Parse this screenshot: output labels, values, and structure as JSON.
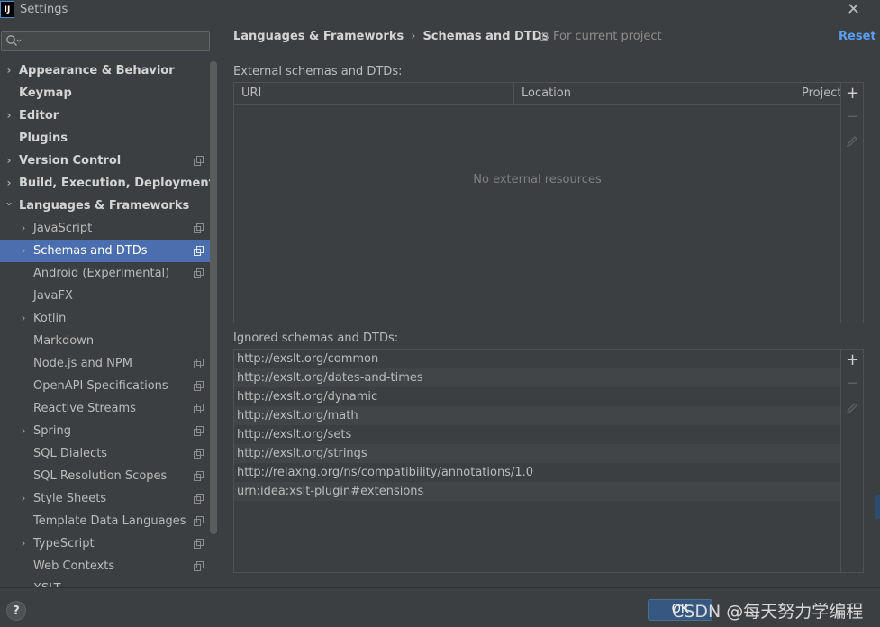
{
  "window": {
    "title": "Settings",
    "app_icon_text": "IJ",
    "close_glyph": "✕"
  },
  "search": {
    "placeholder": "",
    "icon": "search-icon"
  },
  "sidebar": {
    "items": [
      {
        "label": "Appearance & Behavior",
        "level": 0,
        "bold": true,
        "expandable": true,
        "expanded": false,
        "project": false,
        "selected": false
      },
      {
        "label": "Keymap",
        "level": 0,
        "bold": true,
        "expandable": false,
        "expanded": false,
        "project": false,
        "selected": false
      },
      {
        "label": "Editor",
        "level": 0,
        "bold": true,
        "expandable": true,
        "expanded": false,
        "project": false,
        "selected": false
      },
      {
        "label": "Plugins",
        "level": 0,
        "bold": true,
        "expandable": false,
        "expanded": false,
        "project": false,
        "selected": false
      },
      {
        "label": "Version Control",
        "level": 0,
        "bold": true,
        "expandable": true,
        "expanded": false,
        "project": true,
        "selected": false
      },
      {
        "label": "Build, Execution, Deployment",
        "level": 0,
        "bold": true,
        "expandable": true,
        "expanded": false,
        "project": false,
        "selected": false
      },
      {
        "label": "Languages & Frameworks",
        "level": 0,
        "bold": true,
        "expandable": true,
        "expanded": true,
        "project": false,
        "selected": false
      },
      {
        "label": "JavaScript",
        "level": 1,
        "bold": false,
        "expandable": true,
        "expanded": false,
        "project": true,
        "selected": false
      },
      {
        "label": "Schemas and DTDs",
        "level": 1,
        "bold": false,
        "expandable": true,
        "expanded": false,
        "project": true,
        "selected": true
      },
      {
        "label": "Android (Experimental)",
        "level": 1,
        "bold": false,
        "expandable": false,
        "expanded": false,
        "project": true,
        "selected": false
      },
      {
        "label": "JavaFX",
        "level": 1,
        "bold": false,
        "expandable": false,
        "expanded": false,
        "project": false,
        "selected": false
      },
      {
        "label": "Kotlin",
        "level": 1,
        "bold": false,
        "expandable": true,
        "expanded": false,
        "project": false,
        "selected": false
      },
      {
        "label": "Markdown",
        "level": 1,
        "bold": false,
        "expandable": false,
        "expanded": false,
        "project": false,
        "selected": false
      },
      {
        "label": "Node.js and NPM",
        "level": 1,
        "bold": false,
        "expandable": false,
        "expanded": false,
        "project": true,
        "selected": false
      },
      {
        "label": "OpenAPI Specifications",
        "level": 1,
        "bold": false,
        "expandable": false,
        "expanded": false,
        "project": true,
        "selected": false
      },
      {
        "label": "Reactive Streams",
        "level": 1,
        "bold": false,
        "expandable": false,
        "expanded": false,
        "project": true,
        "selected": false
      },
      {
        "label": "Spring",
        "level": 1,
        "bold": false,
        "expandable": true,
        "expanded": false,
        "project": true,
        "selected": false
      },
      {
        "label": "SQL Dialects",
        "level": 1,
        "bold": false,
        "expandable": false,
        "expanded": false,
        "project": true,
        "selected": false
      },
      {
        "label": "SQL Resolution Scopes",
        "level": 1,
        "bold": false,
        "expandable": false,
        "expanded": false,
        "project": true,
        "selected": false
      },
      {
        "label": "Style Sheets",
        "level": 1,
        "bold": false,
        "expandable": true,
        "expanded": false,
        "project": true,
        "selected": false
      },
      {
        "label": "Template Data Languages",
        "level": 1,
        "bold": false,
        "expandable": false,
        "expanded": false,
        "project": true,
        "selected": false
      },
      {
        "label": "TypeScript",
        "level": 1,
        "bold": false,
        "expandable": true,
        "expanded": false,
        "project": true,
        "selected": false
      },
      {
        "label": "Web Contexts",
        "level": 1,
        "bold": false,
        "expandable": false,
        "expanded": false,
        "project": true,
        "selected": false
      },
      {
        "label": "XSLT",
        "level": 1,
        "bold": false,
        "expandable": false,
        "expanded": false,
        "project": false,
        "selected": false
      }
    ]
  },
  "header": {
    "crumb_parent": "Languages & Frameworks",
    "crumb_separator": "›",
    "crumb_current": "Schemas and DTDs",
    "scope_label": "For current project",
    "reset_label": "Reset"
  },
  "external": {
    "label": "External schemas and DTDs:",
    "columns": [
      "URI",
      "Location",
      "Project"
    ],
    "empty_text": "No external resources",
    "add_glyph": "+",
    "remove_glyph": "−",
    "edit_icon": "pencil-icon"
  },
  "ignored": {
    "label": "Ignored schemas and DTDs:",
    "rows": [
      "http://exslt.org/common",
      "http://exslt.org/dates-and-times",
      "http://exslt.org/dynamic",
      "http://exslt.org/math",
      "http://exslt.org/sets",
      "http://exslt.org/strings",
      "http://relaxng.org/ns/compatibility/annotations/1.0",
      "urn:idea:xslt-plugin#extensions"
    ],
    "add_glyph": "+",
    "remove_glyph": "−",
    "edit_icon": "pencil-icon"
  },
  "footer": {
    "help_label": "?",
    "ok_label": "OK",
    "watermark": "CSDN @每天努力学编程"
  },
  "colors": {
    "background": "#3c3f41",
    "selection": "#4b6eaf",
    "link": "#589df6",
    "primary_button": "#365880"
  }
}
